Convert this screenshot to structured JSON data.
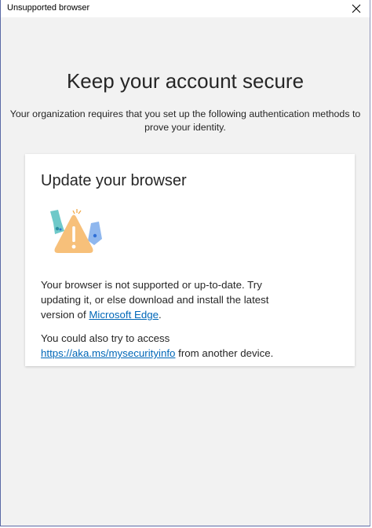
{
  "window": {
    "title": "Unsupported browser",
    "close_icon": "close-icon"
  },
  "page": {
    "heading": "Keep your account secure",
    "subtitle": "Your organization requires that you set up the following authentication methods to prove your identity."
  },
  "card": {
    "title": "Update your browser",
    "illustration_icon": "warning-illustration",
    "message_part1": "Your browser is not supported or up-to-date. Try updating it, or else download and install the latest version of ",
    "edge_link": "Microsoft Edge",
    "message_part1_end": ".",
    "message_part2": "You could also try to access ",
    "security_link": "https://aka.ms/mysecurityinfo",
    "message_part2_end": " from another device."
  },
  "colors": {
    "link": "#0067b8",
    "background": "#f2f2f2",
    "warning_orange": "#f7c07a",
    "accent_blue": "#2f6fd6"
  }
}
